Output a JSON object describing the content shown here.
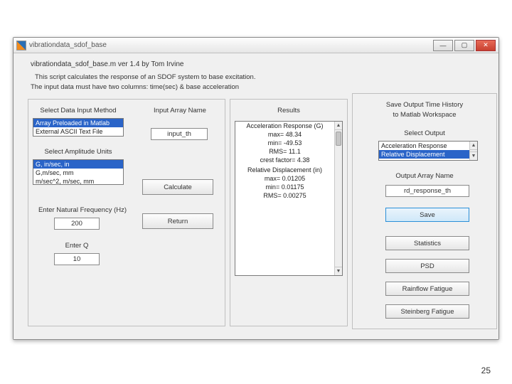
{
  "window": {
    "title": "vibrationdata_sdof_base",
    "min": "—",
    "max": "▢",
    "close": "✕"
  },
  "header": {
    "line1": "vibrationdata_sdof_base.m  ver 1.4  by Tom Irvine",
    "line2": "This script calculates the response of an SDOF system to base excitation.",
    "line3": "The input data must have two columns:  time(sec) & base acceleration"
  },
  "panel1": {
    "select_method_label": "Select Data Input Method",
    "methods": {
      "opt0": "Array Preloaded in Matlab",
      "opt1": "External ASCII Text File"
    },
    "amp_label": "Select Amplitude Units",
    "amp": {
      "opt0": "G, in/sec, in",
      "opt1": "G,m/sec, mm",
      "opt2": "m/sec^2, m/sec, mm"
    },
    "fn_label": "Enter Natural Frequency (Hz)",
    "fn_value": "200",
    "q_label": "Enter Q",
    "q_value": "10",
    "input_array_label": "Input Array Name",
    "input_array_value": "input_th",
    "calculate_btn": "Calculate",
    "return_btn": "Return"
  },
  "results": {
    "title": "Results",
    "l1": "Acceleration Response (G)",
    "l2": "max=  48.34",
    "l3": "min= -49.53",
    "l4": "RMS=  11.1",
    "l5": "crest factor=  4.38",
    "l6": "",
    "l7": "Relative Displacement (in)",
    "l8": "max= 0.01205",
    "l9": "min= 0.01175",
    "l10": "RMS= 0.00275"
  },
  "panel3": {
    "line1": "Save Output Time History",
    "line2": "to Matlab Workspace",
    "select_output_label": "Select Output",
    "outputs": {
      "opt0": "Acceleration Response",
      "opt1": "Relative Displacement"
    },
    "out_array_label": "Output Array Name",
    "out_array_value": "rd_response_th",
    "save_btn": "Save",
    "stats_btn": "Statistics",
    "psd_btn": "PSD",
    "rainflow_btn": "Rainflow Fatigue",
    "steinberg_btn": "Steinberg Fatigue"
  },
  "page_number": "25"
}
